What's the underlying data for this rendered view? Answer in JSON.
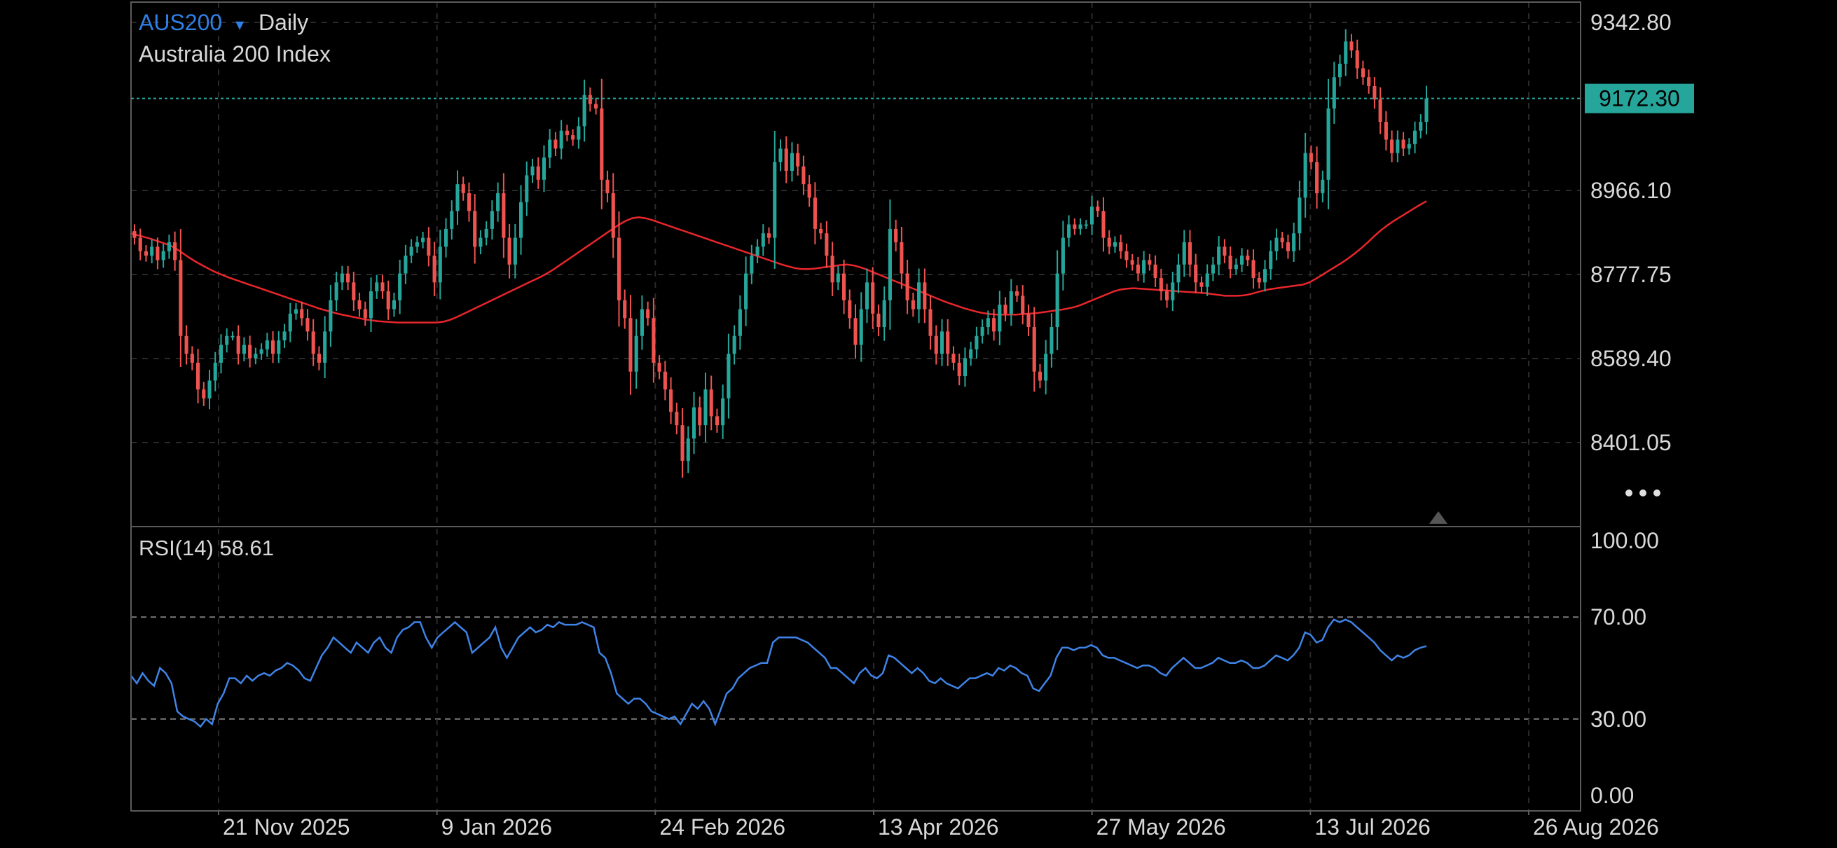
{
  "header": {
    "symbol": "AUS200",
    "symbol_caret": "▾",
    "timeframe": "Daily",
    "instrument_name": "Australia 200 Index"
  },
  "price_panel": {
    "current_price_label": "9172.30",
    "more_icon": "more-horizontal-icon",
    "scroll_marker_icon": "triangle-up-icon"
  },
  "rsi_panel": {
    "label": "RSI(14) 58.61"
  },
  "colors": {
    "background": "#000000",
    "grid": "#2a2a2a",
    "frame": "#5a5a5a",
    "text": "#d8d8d8",
    "symbol": "#2f7fe6",
    "up": "#26a69a",
    "down": "#ef5350",
    "ma": "#e8262b",
    "rsi": "#3f83e6",
    "price_line": "#26a69a",
    "price_tag_bg": "#26a69a",
    "price_tag_text": "#000000"
  },
  "chart_data": [
    {
      "type": "candlestick",
      "title": "AUS200 Daily",
      "subtitle": "Australia 200 Index",
      "y_axis_ticks": [
        "9342.80",
        "8966.10",
        "8777.75",
        "8589.40",
        "8401.05"
      ],
      "x_axis_ticks": [
        "21 Nov 2025",
        "9 Jan 2026",
        "24 Feb 2026",
        "13 Apr 2026",
        "27 May 2026",
        "13 Jul 2026",
        "26 Aug 2026"
      ],
      "last_price": 9172.3,
      "grid": true,
      "close": [
        8860,
        8830,
        8820,
        8840,
        8810,
        8830,
        8850,
        8810,
        8640,
        8600,
        8580,
        8520,
        8500,
        8540,
        8580,
        8620,
        8640,
        8640,
        8600,
        8620,
        8590,
        8600,
        8610,
        8630,
        8600,
        8630,
        8650,
        8690,
        8700,
        8680,
        8650,
        8600,
        8580,
        8650,
        8720,
        8760,
        8780,
        8760,
        8720,
        8700,
        8680,
        8740,
        8760,
        8740,
        8700,
        8720,
        8780,
        8820,
        8840,
        8850,
        8860,
        8820,
        8760,
        8840,
        8880,
        8920,
        8980,
        8960,
        8920,
        8840,
        8860,
        8880,
        8920,
        8960,
        8860,
        8800,
        8860,
        8940,
        9000,
        9020,
        8990,
        9040,
        9080,
        9060,
        9100,
        9090,
        9080,
        9110,
        9180,
        9160,
        9150,
        8990,
        8960,
        8860,
        8720,
        8680,
        8560,
        8640,
        8700,
        8680,
        8580,
        8560,
        8520,
        8470,
        8440,
        8360,
        8410,
        8480,
        8440,
        8520,
        8460,
        8440,
        8500,
        8600,
        8640,
        8700,
        8780,
        8820,
        8840,
        8870,
        8860,
        9030,
        9060,
        9010,
        9050,
        9020,
        8980,
        8950,
        8880,
        8870,
        8820,
        8760,
        8780,
        8720,
        8680,
        8620,
        8700,
        8760,
        8690,
        8660,
        8720,
        8880,
        8850,
        8780,
        8720,
        8700,
        8760,
        8700,
        8640,
        8600,
        8650,
        8600,
        8580,
        8550,
        8590,
        8610,
        8640,
        8660,
        8680,
        8650,
        8710,
        8690,
        8740,
        8730,
        8690,
        8660,
        8560,
        8540,
        8600,
        8660,
        8780,
        8860,
        8890,
        8880,
        8890,
        8890,
        8930,
        8920,
        8860,
        8840,
        8850,
        8830,
        8810,
        8800,
        8780,
        8810,
        8800,
        8770,
        8740,
        8720,
        8760,
        8800,
        8850,
        8800,
        8760,
        8750,
        8780,
        8800,
        8840,
        8820,
        8790,
        8800,
        8820,
        8810,
        8770,
        8760,
        8790,
        8830,
        8860,
        8850,
        8830,
        8870,
        8950,
        9050,
        9030,
        8960,
        8990,
        9150,
        9220,
        9250,
        9300,
        9280,
        9240,
        9220,
        9200,
        9170,
        9120,
        9080,
        9050,
        9080,
        9060,
        9070,
        9100,
        9120,
        9172.3
      ],
      "ma": {
        "name": "",
        "values": [
          8870,
          8866,
          8862,
          8858,
          8853,
          8848,
          8843,
          8835,
          8825,
          8815,
          8806,
          8798,
          8790,
          8783,
          8777,
          8771,
          8766,
          8761,
          8756,
          8751,
          8746,
          8741,
          8736,
          8731,
          8726,
          8721,
          8716,
          8711,
          8706,
          8701,
          8697,
          8693,
          8689,
          8686,
          8683,
          8680,
          8677,
          8675,
          8673,
          8672,
          8671,
          8670,
          8670,
          8670,
          8670,
          8670,
          8670,
          8670,
          8672,
          8676,
          8682,
          8689,
          8696,
          8703,
          8710,
          8717,
          8724,
          8731,
          8738,
          8745,
          8752,
          8759,
          8766,
          8773,
          8781,
          8790,
          8800,
          8810,
          8820,
          8830,
          8840,
          8850,
          8860,
          8870,
          8880,
          8890,
          8898,
          8904,
          8906,
          8904,
          8900,
          8895,
          8890,
          8885,
          8880,
          8875,
          8870,
          8865,
          8860,
          8855,
          8850,
          8845,
          8840,
          8835,
          8830,
          8825,
          8820,
          8815,
          8810,
          8805,
          8800,
          8796,
          8792,
          8790,
          8790,
          8791,
          8793,
          8795,
          8797,
          8799,
          8800,
          8798,
          8794,
          8789,
          8783,
          8777,
          8771,
          8765,
          8759,
          8753,
          8747,
          8741,
          8735,
          8729,
          8723,
          8717,
          8712,
          8707,
          8702,
          8698,
          8694,
          8691,
          8689,
          8688,
          8688,
          8688,
          8688,
          8689,
          8690,
          8691,
          8693,
          8695,
          8697,
          8699,
          8702,
          8705,
          8710,
          8716,
          8722,
          8728,
          8734,
          8740,
          8744,
          8746,
          8747,
          8746,
          8745,
          8744,
          8743,
          8742,
          8741,
          8740,
          8739,
          8738,
          8737,
          8736,
          8734,
          8732,
          8730,
          8730,
          8730,
          8731,
          8734,
          8738,
          8742,
          8745,
          8747,
          8749,
          8751,
          8753,
          8755,
          8760,
          8768,
          8777,
          8786,
          8795,
          8804,
          8814,
          8825,
          8837,
          8850,
          8864,
          8877,
          8888,
          8898,
          8907,
          8916,
          8925,
          8934,
          8942
        ]
      }
    },
    {
      "type": "line",
      "title": "RSI(14) 58.61",
      "y_axis_ticks": [
        "100.00",
        "70.00",
        "30.00",
        "0.00"
      ],
      "ylim": [
        0,
        100
      ],
      "reference_lines": [
        70,
        30
      ],
      "last_value": 58.61,
      "values": [
        47,
        44,
        48,
        45,
        43,
        50,
        48,
        44,
        33,
        31,
        30,
        29,
        27,
        30,
        28,
        36,
        40,
        46,
        46,
        44,
        47,
        45,
        47,
        48,
        47,
        49,
        50,
        52,
        51,
        49,
        46,
        45,
        50,
        55,
        58,
        62,
        60,
        58,
        56,
        60,
        58,
        56,
        60,
        62,
        58,
        56,
        62,
        65,
        66,
        68,
        68,
        62,
        58,
        62,
        64,
        66,
        68,
        66,
        64,
        56,
        58,
        60,
        62,
        66,
        58,
        54,
        58,
        62,
        64,
        66,
        64,
        65,
        67,
        66,
        68,
        67,
        67,
        67,
        68,
        67,
        66,
        56,
        54,
        48,
        40,
        38,
        36,
        38,
        38,
        36,
        33,
        32,
        31,
        30,
        31,
        28,
        32,
        36,
        34,
        37,
        34,
        28,
        34,
        40,
        42,
        46,
        48,
        50,
        51,
        52,
        52,
        60,
        62,
        62,
        62,
        62,
        61,
        60,
        58,
        56,
        54,
        50,
        50,
        48,
        46,
        44,
        48,
        50,
        47,
        46,
        48,
        55,
        54,
        52,
        50,
        48,
        50,
        48,
        45,
        44,
        46,
        44,
        43,
        42,
        44,
        46,
        46,
        47,
        48,
        47,
        50,
        49,
        51,
        50,
        48,
        47,
        42,
        41,
        44,
        47,
        54,
        58,
        58,
        57,
        58,
        58,
        59,
        58,
        55,
        54,
        54,
        53,
        52,
        51,
        50,
        51,
        51,
        50,
        48,
        47,
        50,
        52,
        54,
        52,
        50,
        50,
        51,
        52,
        54,
        53,
        52,
        52,
        53,
        52,
        50,
        50,
        51,
        53,
        55,
        54,
        53,
        55,
        58,
        64,
        63,
        60,
        61,
        66,
        69,
        68,
        69,
        68,
        66,
        64,
        62,
        60,
        57,
        55,
        53,
        55,
        54,
        55,
        57,
        58,
        58.61
      ]
    }
  ]
}
